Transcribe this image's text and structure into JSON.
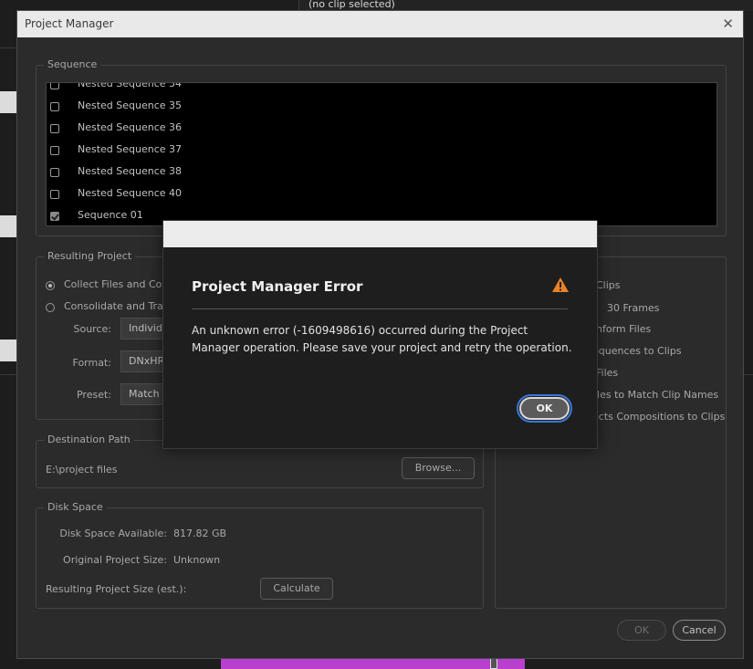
{
  "background": {
    "top_panel_text": "(no clip selected)"
  },
  "window": {
    "title": "Project Manager"
  },
  "sequence": {
    "label": "Sequence",
    "items": [
      {
        "label": "Nested Sequence 34",
        "checked": false
      },
      {
        "label": "Nested Sequence 35",
        "checked": false
      },
      {
        "label": "Nested Sequence 36",
        "checked": false
      },
      {
        "label": "Nested Sequence 37",
        "checked": false
      },
      {
        "label": "Nested Sequence 38",
        "checked": false
      },
      {
        "label": "Nested Sequence 40",
        "checked": false
      },
      {
        "label": "Sequence 01",
        "checked": true
      }
    ]
  },
  "resulting_project": {
    "label": "Resulting Project",
    "option_collect": "Collect Files and Copy",
    "option_consolidate": "Consolidate and Trans",
    "source_label": "Source:",
    "source_value": "Individu",
    "format_label": "Format:",
    "format_value": "DNxHR/",
    "preset_label": "Preset:",
    "preset_value": "Match S"
  },
  "options": {
    "clips": "Clips",
    "frames": "30 Frames",
    "conform": "nform Files",
    "sequences": "equences to Clips",
    "files": "Files",
    "rename": "iles to Match Clip Names",
    "ae": "ects Compositions to Clips"
  },
  "destination": {
    "label": "Destination Path",
    "path": "E:\\project files",
    "browse": "Browse..."
  },
  "disk": {
    "label": "Disk Space",
    "available_label": "Disk Space Available:",
    "available_value": "817.82 GB",
    "original_label": "Original Project Size:",
    "original_value": "Unknown",
    "resulting_label": "Resulting Project Size (est.):",
    "calculate": "Calculate"
  },
  "footer": {
    "ok": "OK",
    "cancel": "Cancel"
  },
  "error_dialog": {
    "title": "Project Manager Error",
    "message": "An unknown error (-1609498616) occurred during the Project Manager operation. Please save your project and retry the operation.",
    "ok": "OK",
    "warning_color": "#e8832a"
  }
}
